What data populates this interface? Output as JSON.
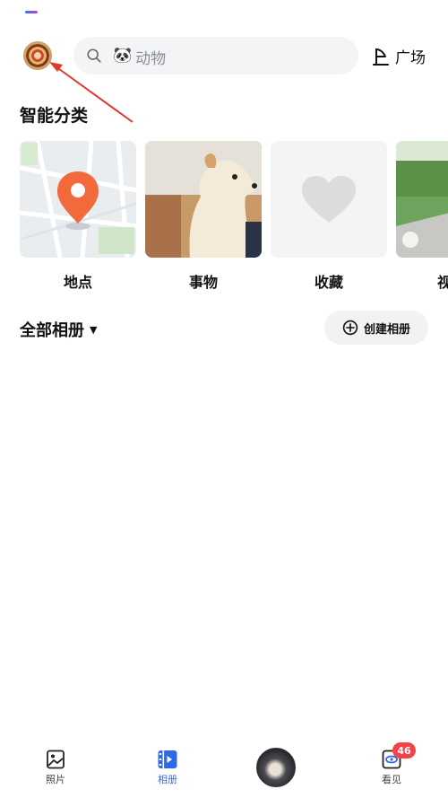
{
  "header": {
    "search_placeholder": "动物",
    "plaza_label": "广场"
  },
  "smart": {
    "title": "智能分类",
    "cards": [
      {
        "label": "地点"
      },
      {
        "label": "事物"
      },
      {
        "label": "收藏"
      },
      {
        "label": "视"
      }
    ]
  },
  "albums": {
    "title": "全部相册",
    "create_label": "创建相册"
  },
  "nav": {
    "items": [
      {
        "label": "照片"
      },
      {
        "label": "相册"
      },
      {
        "label": "看见"
      }
    ],
    "badge": "46"
  },
  "colors": {
    "accent": "#2f6ae6",
    "badge": "#f2434a",
    "annotation_arrow": "#e2382b"
  }
}
